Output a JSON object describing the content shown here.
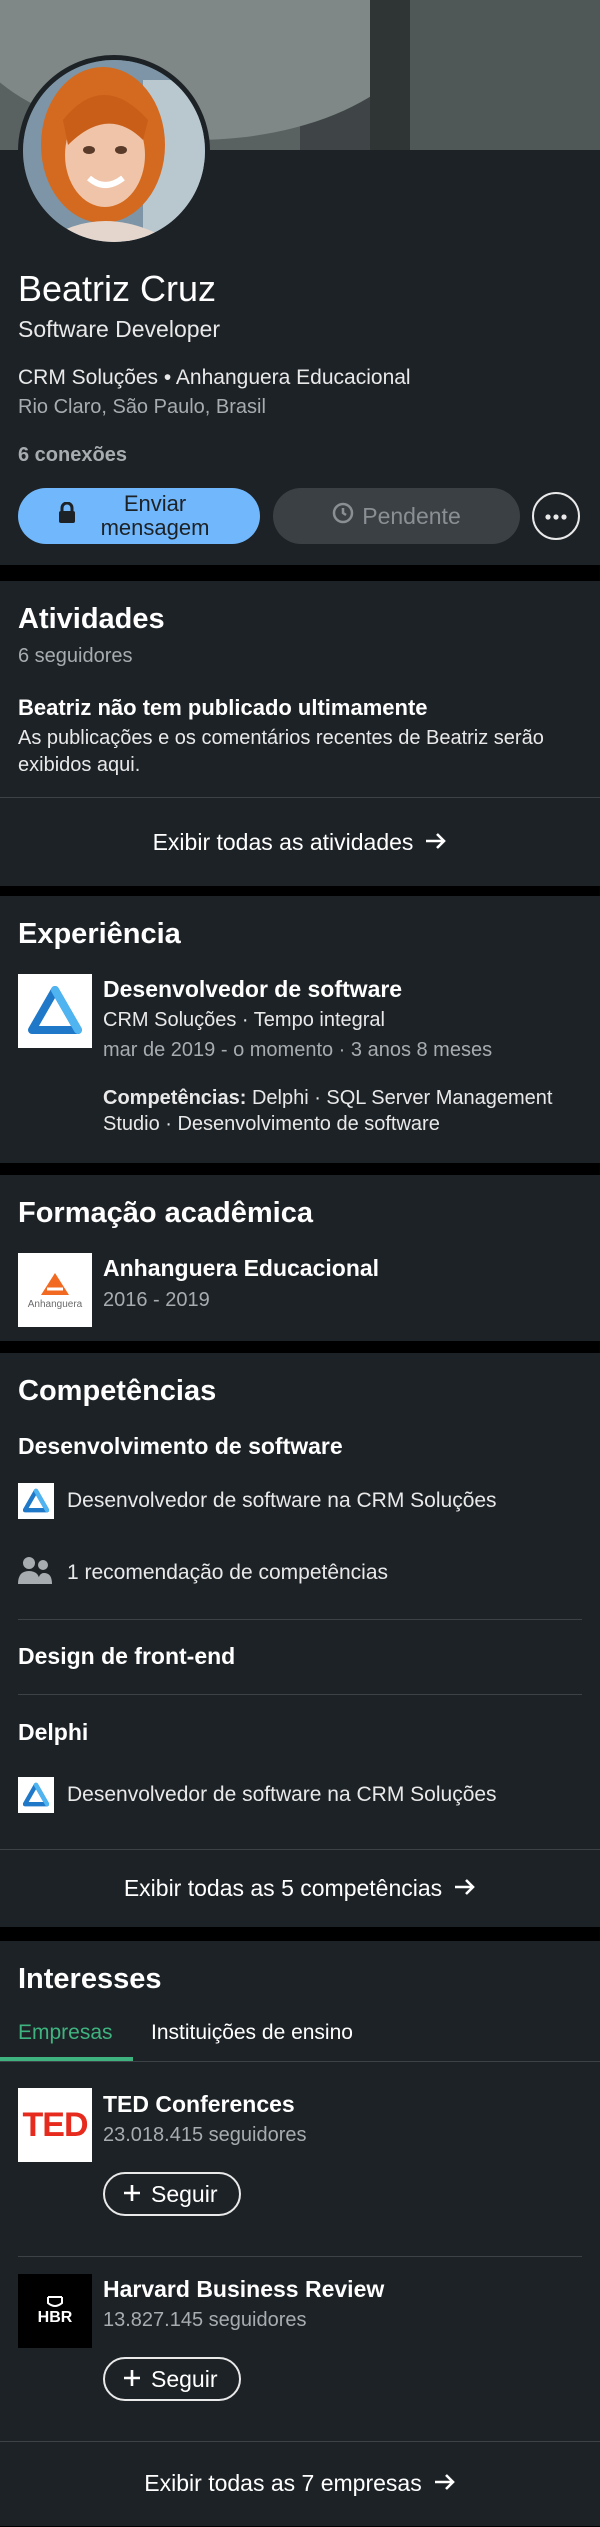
{
  "profile": {
    "name": "Beatriz Cruz",
    "headline": "Software Developer",
    "company_line": "CRM Soluções • Anhanguera Educacional",
    "location": "Rio Claro, São Paulo, Brasil",
    "connections": "6 conexões",
    "message_label": "Enviar mensagem",
    "pending_label": "Pendente",
    "accent_color": "#71b7fb"
  },
  "activity": {
    "title": "Atividades",
    "followers": "6 seguidores",
    "empty_title": "Beatriz não tem publicado ultimamente",
    "empty_text": "As publicações e os comentários recentes de Beatriz serão exibidos aqui.",
    "show_all": "Exibir todas as atividades"
  },
  "experience": {
    "title": "Experiência",
    "items": [
      {
        "role": "Desenvolvedor de software",
        "company": "CRM Soluções · Tempo integral",
        "dates": "mar de 2019 - o momento · 3 anos 8 meses",
        "skills_label": "Competências:",
        "skills": "Delphi · SQL Server Management Studio · Desenvolvimento de software"
      }
    ]
  },
  "education": {
    "title": "Formação acadêmica",
    "items": [
      {
        "school": "Anhanguera Educacional",
        "years": "2016 - 2019",
        "logo_text": "Anhanguera"
      }
    ]
  },
  "skills": {
    "title": "Competências",
    "items": [
      {
        "name": "Desenvolvimento de software",
        "detail": "Desenvolvedor de software na CRM Soluções",
        "endorsement": "1 recomendação de competências"
      },
      {
        "name": "Design de front-end"
      },
      {
        "name": "Delphi",
        "detail": "Desenvolvedor de software na CRM Soluções"
      }
    ],
    "show_all": "Exibir todas as 5 competências"
  },
  "interests": {
    "title": "Interesses",
    "tabs": [
      "Empresas",
      "Instituições de ensino"
    ],
    "active_color": "#3fb37f",
    "companies": [
      {
        "name": "TED Conferences",
        "followers": "23.018.415 seguidores",
        "logo_text": "TED",
        "follow_label": "Seguir"
      },
      {
        "name": "Harvard Business Review",
        "followers": "13.827.145 seguidores",
        "logo_text": "HBR",
        "follow_label": "Seguir"
      }
    ],
    "show_all": "Exibir todas as 7 empresas"
  }
}
